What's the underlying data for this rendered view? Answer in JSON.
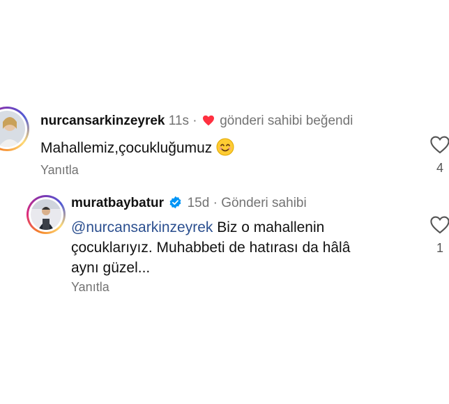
{
  "comments": [
    {
      "username": "nurcansarkinzeyrek",
      "time": "11s",
      "separator": "·",
      "liked_by_author": "gönderi sahibi beğendi",
      "text": "Mahallemiz,çocukluğumuz",
      "emoji_icon": "smiling-face-emoji",
      "reply_label": "Yanıtla",
      "like_count": "4"
    },
    {
      "username": "muratbaybatur",
      "time": "15d",
      "separator": "·",
      "author_badge": "Gönderi sahibi",
      "mention": "@nurcansarkinzeyrek",
      "text_line1": " Biz o mahallenin",
      "text_line2": "çocuklarıyız. Muhabbeti de hatırası da hâlâ",
      "text_line3": "aynı güzel...",
      "reply_label": "Yanıtla",
      "like_count": "1"
    }
  ],
  "colors": {
    "heart_red": "#ff3040",
    "verified_blue": "#0095f6",
    "mention_blue": "#2b4f8f",
    "meta_gray": "#737373"
  }
}
